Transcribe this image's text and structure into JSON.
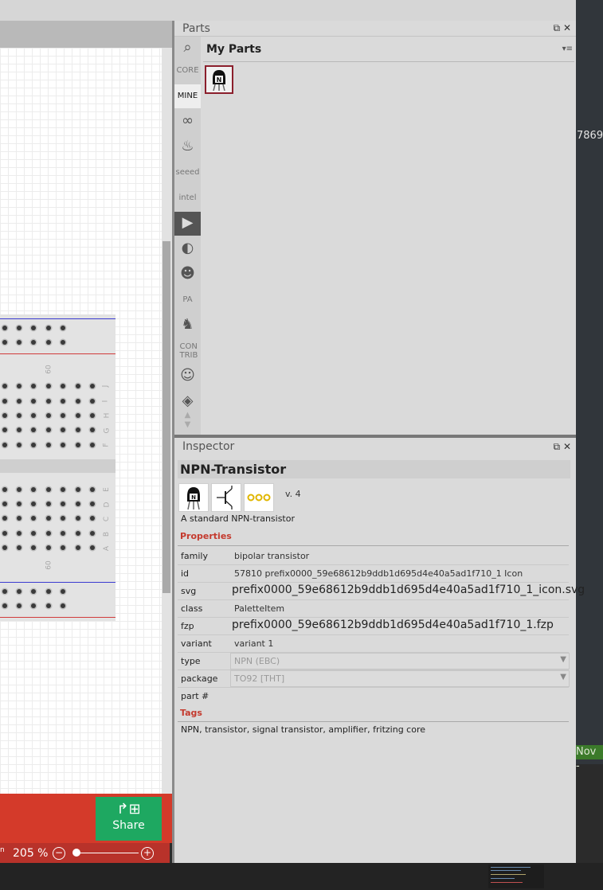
{
  "desktop": {
    "side_number": "7869",
    "side_badge": "Nov -"
  },
  "canvas": {
    "breadboard_labels": {
      "top_num": "60",
      "bottom_num": "60",
      "rows_top": [
        "J",
        "I",
        "H",
        "G",
        "F"
      ],
      "rows_bottom": [
        "E",
        "D",
        "C",
        "B",
        "A"
      ]
    },
    "share_label": "Share",
    "zoom": "205 %",
    "zoom_unit_hint": "n",
    "zoom_level_fraction": 0.05
  },
  "parts_panel": {
    "title": "Parts",
    "bins": [
      {
        "name": "search",
        "label": ""
      },
      {
        "name": "core",
        "label": "CORE"
      },
      {
        "name": "mine",
        "label": "MINE"
      },
      {
        "name": "arduino",
        "label": ""
      },
      {
        "name": "sparkfun",
        "label": ""
      },
      {
        "name": "seeed",
        "label": "seeed"
      },
      {
        "name": "intel",
        "label": "intel"
      },
      {
        "name": "play",
        "label": ""
      },
      {
        "name": "snootlab",
        "label": ""
      },
      {
        "name": "animal",
        "label": ""
      },
      {
        "name": "pa",
        "label": "PA"
      },
      {
        "name": "piano",
        "label": ""
      },
      {
        "name": "contrib",
        "label": "CON TRIB"
      },
      {
        "name": "bot",
        "label": ""
      },
      {
        "name": "diamond",
        "label": ""
      }
    ],
    "bin_title": "My Parts",
    "menu_glyph": "▾≡"
  },
  "inspector": {
    "title": "Inspector",
    "part_title": "NPN-Transistor",
    "version": "v. 4",
    "description": "A standard NPN-transistor",
    "properties_heading": "Properties",
    "properties": {
      "family": {
        "key": "family",
        "value": "bipolar transistor"
      },
      "id": {
        "key": "id",
        "value": "57810 prefix0000_59e68612b9ddb1d695d4e40a5ad1f710_1 Icon"
      },
      "svg": {
        "key": "svg",
        "value": "prefix0000_59e68612b9ddb1d695d4e40a5ad1f710_1_icon.svg"
      },
      "class": {
        "key": "class",
        "value": "PaletteItem"
      },
      "fzp": {
        "key": "fzp",
        "value": "prefix0000_59e68612b9ddb1d695d4e40a5ad1f710_1.fzp"
      },
      "variant": {
        "key": "variant",
        "value": "variant 1"
      },
      "type": {
        "key": "type",
        "value": "NPN (EBC)"
      },
      "package": {
        "key": "package",
        "value": "TO92 [THT]"
      },
      "partnum": {
        "key": "part #",
        "value": ""
      }
    },
    "tags_heading": "Tags",
    "tags": "NPN, transistor, signal transistor, amplifier, fritzing core"
  },
  "colors": {
    "accent_red": "#c43a2e",
    "share_green": "#1ea861",
    "status_red": "#b8322a",
    "part_border": "#8b1f2c"
  }
}
